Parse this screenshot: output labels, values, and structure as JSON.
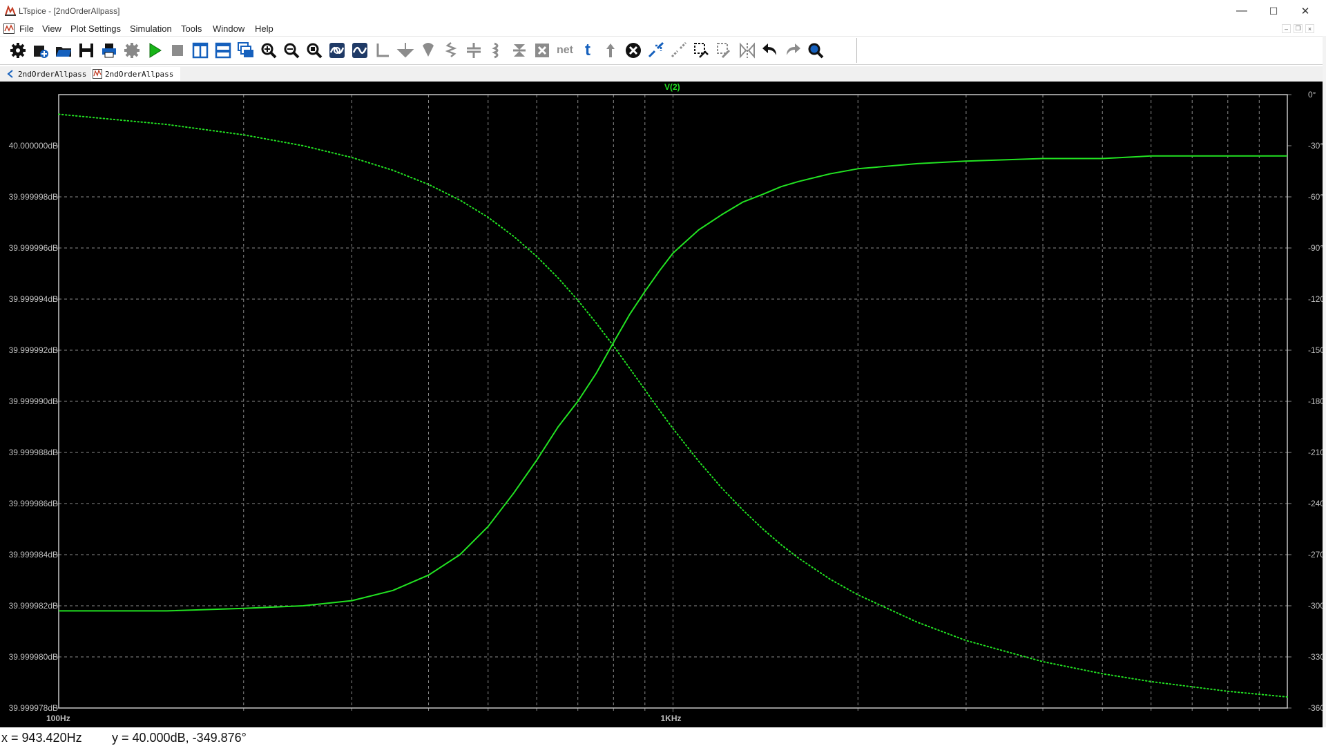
{
  "window": {
    "title": "LTspice - [2ndOrderAllpass]",
    "minimize": "—",
    "maximize": "☐",
    "close": "✕"
  },
  "menu": {
    "items": [
      "File",
      "View",
      "Plot Settings",
      "Simulation",
      "Tools",
      "Window",
      "Help"
    ]
  },
  "mdi": {
    "min": "–",
    "restore": "❐",
    "close": "×"
  },
  "toolbar": {
    "icons": [
      "settings-icon",
      "open-schematic-icon",
      "open-folder-icon",
      "save-icon",
      "print-icon",
      "halt-gear-icon",
      "run-icon",
      "stop-icon",
      "tile-vertical-icon",
      "tile-horizontal-icon",
      "cascade-icon",
      "zoom-in-icon",
      "zoom-out-icon",
      "zoom-fit-icon",
      "autorange-icon",
      "pan-icon",
      "wire-icon",
      "ground-icon",
      "resistor-icon",
      "capacitor-icon",
      "inductor-icon",
      "diode-icon",
      "component-icon",
      "net-label-icon",
      "text-icon",
      "spice-directive-icon",
      "delete-icon",
      "move-icon",
      "drag-icon",
      "rotate-icon",
      "mirror-icon",
      "duplicate-icon",
      "undo-icon",
      "redo-icon",
      "find-icon"
    ],
    "net_label": "net",
    "text_label": "t"
  },
  "tabs": [
    {
      "label": "2ndOrderAllpass",
      "type": "schematic"
    },
    {
      "label": "2ndOrderAllpass",
      "type": "waveform"
    }
  ],
  "plot": {
    "background": "#000000",
    "trace_color": "#22e322",
    "grid_color": "#8c8c8c",
    "trace_label": "V(2)",
    "status": {
      "x": "x = 943.420Hz",
      "y": "y = 40.000dB, -349.876°"
    }
  },
  "chart_data": {
    "type": "line",
    "x_scale": "log",
    "xlim": [
      100,
      10000
    ],
    "x_tick_labels": [
      {
        "value": 100,
        "label": "100Hz"
      },
      {
        "value": 1000,
        "label": "1KHz"
      }
    ],
    "left_axis": {
      "unit": "dB",
      "ylim": [
        39.999978,
        40.000002
      ],
      "ticks": [
        {
          "value": 40.0,
          "label": "40.000000dB"
        },
        {
          "value": 39.999998,
          "label": "39.999998dB"
        },
        {
          "value": 39.999996,
          "label": "39.999996dB"
        },
        {
          "value": 39.999994,
          "label": "39.999994dB"
        },
        {
          "value": 39.999992,
          "label": "39.999992dB"
        },
        {
          "value": 39.99999,
          "label": "39.999990dB"
        },
        {
          "value": 39.999988,
          "label": "39.999988dB"
        },
        {
          "value": 39.999986,
          "label": "39.999986dB"
        },
        {
          "value": 39.999984,
          "label": "39.999984dB"
        },
        {
          "value": 39.999982,
          "label": "39.999982dB"
        },
        {
          "value": 39.99998,
          "label": "39.999980dB"
        },
        {
          "value": 39.999978,
          "label": "39.999978dB"
        }
      ]
    },
    "right_axis": {
      "unit": "deg",
      "ylim": [
        -360,
        0
      ],
      "ticks": [
        {
          "value": 0,
          "label": "0°"
        },
        {
          "value": -30,
          "label": "-30°"
        },
        {
          "value": -60,
          "label": "-60°"
        },
        {
          "value": -90,
          "label": "-90°"
        },
        {
          "value": -120,
          "label": "-120°"
        },
        {
          "value": -150,
          "label": "-150°"
        },
        {
          "value": -180,
          "label": "-180°"
        },
        {
          "value": -210,
          "label": "-210°"
        },
        {
          "value": -240,
          "label": "-240°"
        },
        {
          "value": -270,
          "label": "-270°"
        },
        {
          "value": -300,
          "label": "-300°"
        },
        {
          "value": -330,
          "label": "-330°"
        },
        {
          "value": -360,
          "label": "-360°"
        }
      ]
    },
    "grid": true,
    "series": [
      {
        "axis": "left",
        "style": "solid",
        "x": [
          100,
          150,
          200,
          250,
          300,
          350,
          400,
          450,
          500,
          550,
          600,
          650,
          700,
          750,
          800,
          850,
          900,
          950,
          1000,
          1100,
          1200,
          1300,
          1400,
          1500,
          1600,
          1800,
          2000,
          2500,
          3000,
          4000,
          5000,
          6000,
          8000,
          10000
        ],
        "values": [
          39.9999818,
          39.9999818,
          39.9999819,
          39.999982,
          39.9999822,
          39.9999826,
          39.9999832,
          39.999984,
          39.9999851,
          39.9999864,
          39.9999877,
          39.999989,
          39.99999,
          39.9999911,
          39.9999923,
          39.9999934,
          39.9999943,
          39.9999951,
          39.9999958,
          39.9999967,
          39.9999973,
          39.9999978,
          39.9999981,
          39.9999984,
          39.9999986,
          39.9999989,
          39.9999991,
          39.9999993,
          39.9999994,
          39.9999995,
          39.9999995,
          39.9999996,
          39.9999996,
          39.9999996
        ]
      },
      {
        "axis": "right",
        "style": "dotted",
        "x": [
          100,
          150,
          200,
          250,
          300,
          350,
          400,
          450,
          500,
          550,
          600,
          650,
          700,
          750,
          800,
          850,
          900,
          950,
          1000,
          1100,
          1200,
          1300,
          1400,
          1500,
          1600,
          1800,
          2000,
          2500,
          3000,
          4000,
          5000,
          6000,
          8000,
          10000
        ],
        "values": [
          -11.5,
          -17.5,
          -23.6,
          -30,
          -36.9,
          -44.4,
          -52.7,
          -61.9,
          -72,
          -83.1,
          -95,
          -107.6,
          -120.7,
          -134.1,
          -147.5,
          -160.6,
          -173.2,
          -185.1,
          -196,
          -215,
          -230.8,
          -243.9,
          -254.9,
          -264.2,
          -272,
          -284.3,
          -293.6,
          -309.7,
          -320.4,
          -332.8,
          -339.9,
          -344.5,
          -350.2,
          -353.5
        ]
      }
    ]
  }
}
